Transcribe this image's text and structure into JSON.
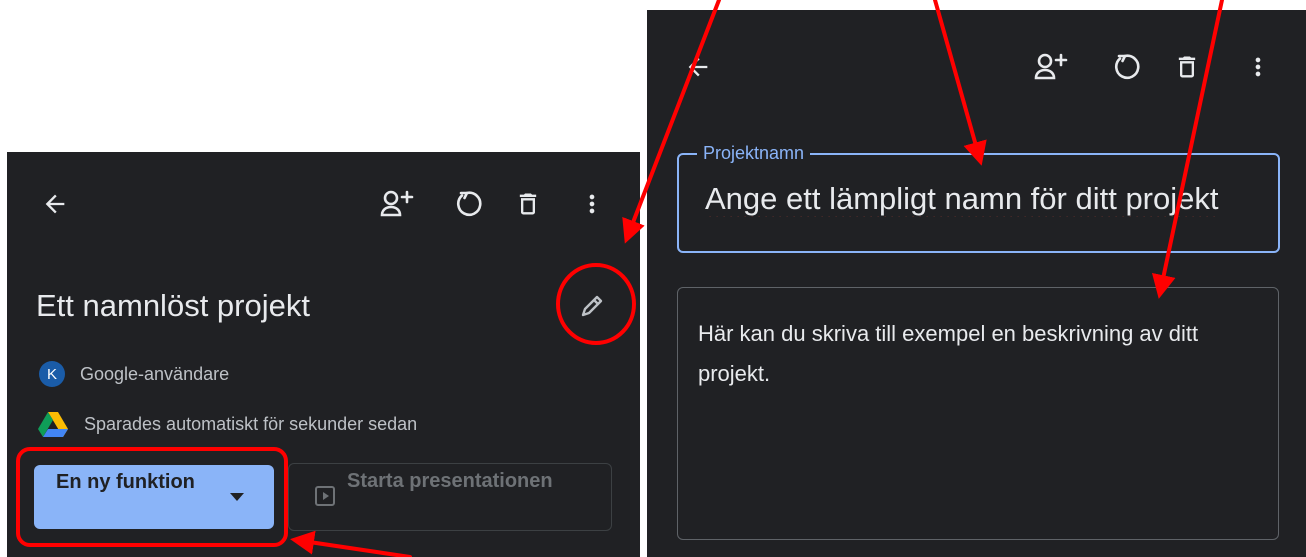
{
  "colors": {
    "panel_bg": "#202124",
    "accent": "#8ab4f8",
    "annotation": "#ff0000",
    "text": "#e8eaed",
    "muted": "#bdc1c6"
  },
  "left_panel": {
    "toolbar": {
      "icons": [
        "arrow-back-icon",
        "person-add-icon",
        "refresh-icon",
        "trash-icon",
        "more-vert-icon"
      ]
    },
    "project_title": "Ett namnlöst projekt",
    "edit_icon": "pencil-icon",
    "owner": {
      "avatar_initial": "K",
      "name": "Google-användare"
    },
    "save_status": {
      "icon": "google-drive-icon",
      "text": "Sparades automatiskt för sekunder sedan"
    },
    "new_feature_button": {
      "label": "En ny funktion",
      "icon": "dropdown-caret-icon"
    },
    "present_button": {
      "label": "Starta presentationen",
      "icon": "slideshow-icon",
      "disabled": true
    }
  },
  "right_panel": {
    "toolbar": {
      "icons": [
        "arrow-back-icon",
        "person-add-icon",
        "refresh-icon",
        "trash-icon",
        "more-vert-icon"
      ]
    },
    "name_field": {
      "label": "Projektnamn",
      "value": "Ange ett lämpligt namn för ditt projekt"
    },
    "description_field": {
      "value": "Här kan du skriva till exempel en beskrivning av ditt projekt."
    }
  },
  "annotations": {
    "type": "red-arrows-and-highlights"
  }
}
